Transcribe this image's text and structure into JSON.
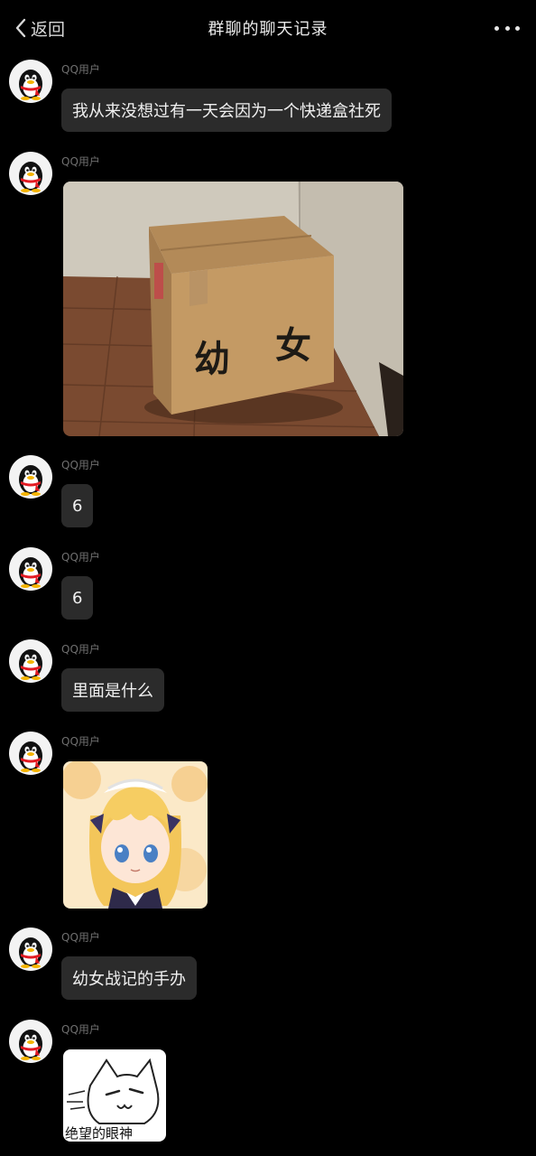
{
  "header": {
    "back_label": "返回",
    "title": "群聊的聊天记录"
  },
  "messages": [
    {
      "sender": "QQ用户",
      "type": "text",
      "text": "我从来没想过有一天会因为一个快递盒社死"
    },
    {
      "sender": "QQ用户",
      "type": "image",
      "image_text": [
        "幼",
        "女"
      ]
    },
    {
      "sender": "QQ用户",
      "type": "text",
      "text": "6"
    },
    {
      "sender": "QQ用户",
      "type": "text",
      "text": "6"
    },
    {
      "sender": "QQ用户",
      "type": "text",
      "text": "里面是什么"
    },
    {
      "sender": "QQ用户",
      "type": "image",
      "image_desc": "anime-girl"
    },
    {
      "sender": "QQ用户",
      "type": "text",
      "text": "幼女战记的手办"
    },
    {
      "sender": "QQ用户",
      "type": "sticker",
      "image_text": "绝望的眼神"
    }
  ],
  "colors": {
    "background": "#000000",
    "bubble": "#2b2b2b",
    "name": "#6f6f6f",
    "text": "#f0f0f0"
  }
}
